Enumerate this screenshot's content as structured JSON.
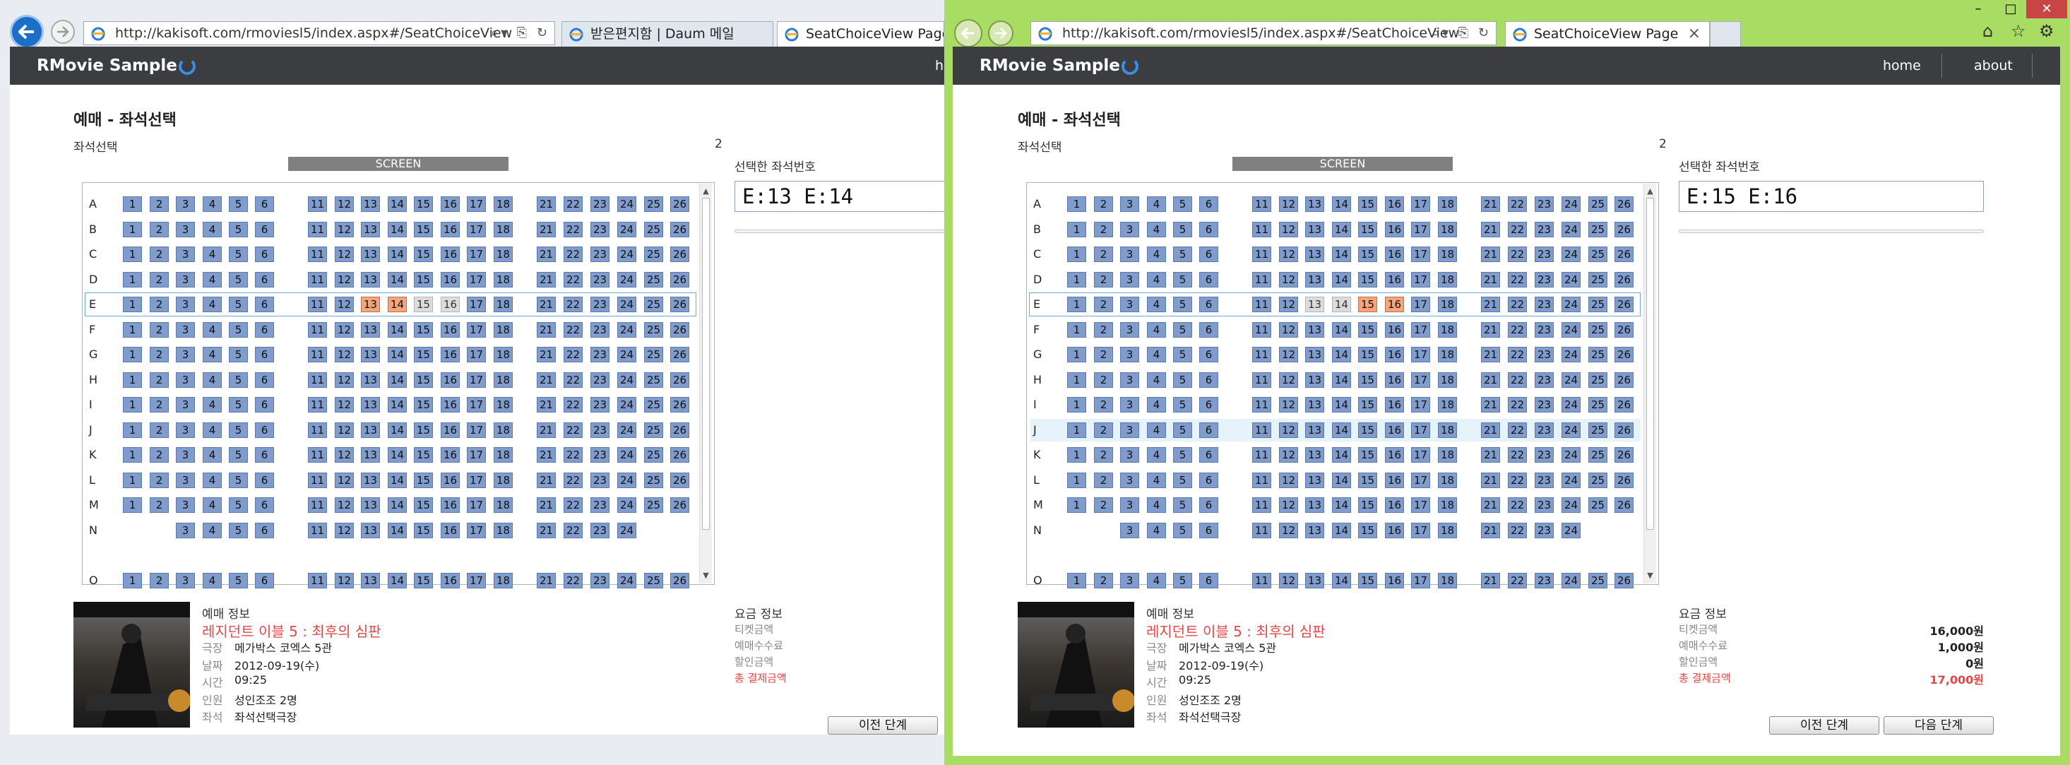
{
  "colors": {
    "left_frame": "#e9edf2",
    "right_frame": "#a9dc63",
    "header": "#3b3d40",
    "seat": "#7f9ccd",
    "seat_selected": "#f6a47a",
    "seat_taken": "#dcdcdc",
    "accent_red": "#e24848"
  },
  "icons": {
    "back": "back-arrow-icon",
    "forward": "forward-arrow-icon",
    "favicon": "ie-page-icon"
  },
  "row_labels": [
    "A",
    "B",
    "C",
    "D",
    "E",
    "F",
    "G",
    "H",
    "I",
    "J",
    "K",
    "L",
    "M",
    "N",
    "",
    "O"
  ],
  "seat_groups": [
    [
      "1",
      "2",
      "3",
      "4",
      "5",
      "6"
    ],
    [
      "11",
      "12",
      "13",
      "14",
      "15",
      "16",
      "17",
      "18"
    ],
    [
      "21",
      "22",
      "23",
      "24",
      "25",
      "26"
    ]
  ],
  "row_n_seats": {
    "group1": [
      "3",
      "4",
      "5",
      "6"
    ],
    "group2": [
      "11",
      "12",
      "13",
      "14",
      "15",
      "16",
      "17",
      "18"
    ],
    "group3": [
      "21",
      "22",
      "23",
      "24"
    ]
  },
  "left": {
    "url": "http://kakisoft.com/rmoviesl5/index.aspx#/SeatChoiceView",
    "tab1": "받은편지함 | Daum 메일",
    "tab2": "SeatChoiceView Page",
    "brand": "RMovie Sample",
    "nav_home_partial": "h",
    "page_title": "예매 - 좌석선택",
    "seat_section": "좌석선택",
    "count": "2",
    "screen": "SCREEN",
    "selected_label": "선택한 좌석번호",
    "selected_value": "E:13 E:14",
    "selected_seats": [
      "E:13",
      "E:14"
    ],
    "taken_seats": [
      "E:15",
      "E:16"
    ],
    "highlight_row": "E",
    "hover_row": "",
    "info_title": "예매 정보",
    "movie_title": "레지던트 이블 5 : 최후의 심판",
    "info": [
      {
        "k": "극장",
        "v": "메가박스 코엑스 5관"
      },
      {
        "k": "날짜",
        "v": "2012-09-19(수)"
      },
      {
        "k": "시간",
        "v": "09:25"
      },
      {
        "k": "인원",
        "v": "성인조조 2명"
      },
      {
        "k": "좌석",
        "v": "좌석선택극장"
      }
    ],
    "fee_title": "요금 정보",
    "fees": [
      {
        "k": "티켓금액",
        "v": ""
      },
      {
        "k": "예매수수료",
        "v": ""
      },
      {
        "k": "할인금액",
        "v": ""
      },
      {
        "k": "총 결제금액",
        "v": ""
      }
    ],
    "prev_button": "이전 단계"
  },
  "right": {
    "url": "http://kakisoft.com/rmoviesl5/index.aspx#/SeatChoiceView",
    "tab1": "SeatChoiceView Page",
    "brand": "RMovie Sample",
    "nav_home": "home",
    "nav_about": "about",
    "page_title": "예매 - 좌석선택",
    "seat_section": "좌석선택",
    "count": "2",
    "screen": "SCREEN",
    "selected_label": "선택한 좌석번호",
    "selected_value": "E:15 E:16",
    "selected_seats": [
      "E:15",
      "E:16"
    ],
    "taken_seats": [
      "E:13",
      "E:14"
    ],
    "highlight_row": "E",
    "hover_row": "J",
    "info_title": "예매 정보",
    "movie_title": "레지던트 이블 5 : 최후의 심판",
    "info": [
      {
        "k": "극장",
        "v": "메가박스 코엑스 5관"
      },
      {
        "k": "날짜",
        "v": "2012-09-19(수)"
      },
      {
        "k": "시간",
        "v": "09:25"
      },
      {
        "k": "인원",
        "v": "성인조조 2명"
      },
      {
        "k": "좌석",
        "v": "좌석선택극장"
      }
    ],
    "fee_title": "요금 정보",
    "fees": [
      {
        "k": "티켓금액",
        "v": "16,000원"
      },
      {
        "k": "예매수수료",
        "v": "1,000원"
      },
      {
        "k": "할인금액",
        "v": "0원"
      },
      {
        "k": "총 결제금액",
        "v": "17,000원"
      }
    ],
    "prev_button": "이전 단계",
    "next_button": "다음 단계"
  }
}
